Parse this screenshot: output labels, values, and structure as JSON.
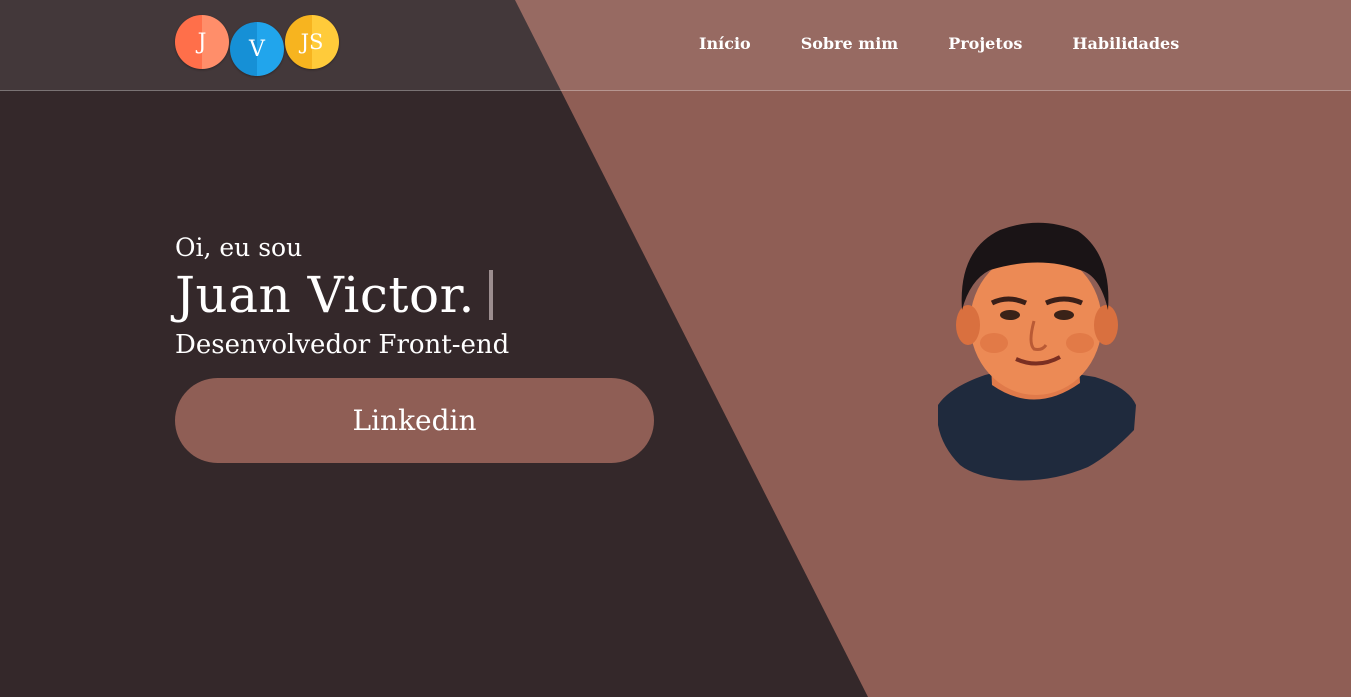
{
  "colors": {
    "dark_bg": "#34282a",
    "accent_bg": "#8f5e55",
    "button_bg": "#8f5e55",
    "text": "#ffffff"
  },
  "logo": {
    "letters": [
      "J",
      "V",
      "JS"
    ],
    "icon": "jvjs-logo"
  },
  "nav": {
    "items": [
      {
        "label": "Início"
      },
      {
        "label": "Sobre mim"
      },
      {
        "label": "Projetos"
      },
      {
        "label": "Habilidades"
      }
    ]
  },
  "hero": {
    "greeting": "Oi, eu sou",
    "name": "Juan Victor.",
    "role": "Desenvolvedor Front-end",
    "button_label": "Linkedin",
    "portrait": "cartoon-portrait-avatar"
  }
}
